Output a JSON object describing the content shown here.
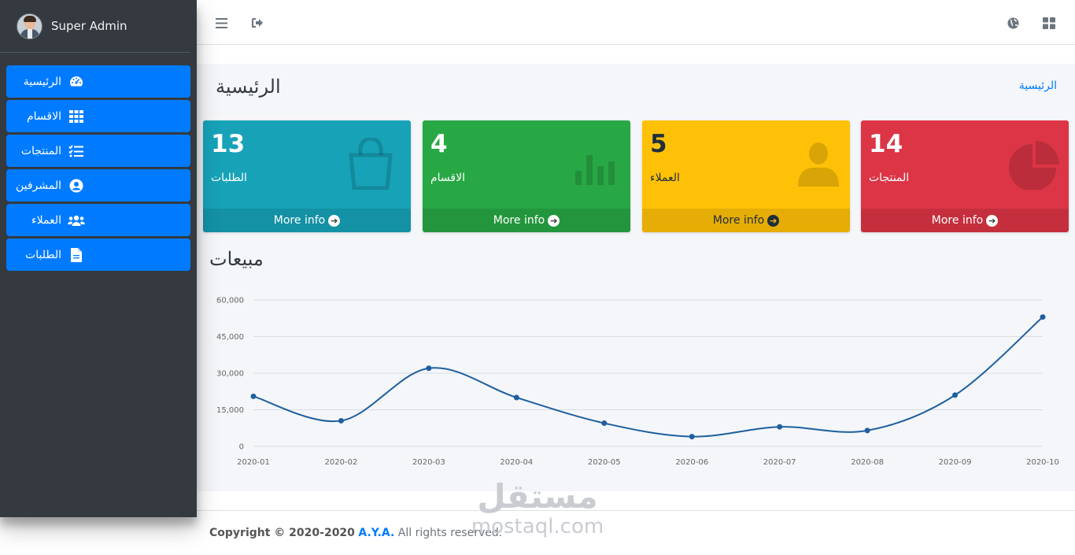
{
  "user": {
    "name": "Super Admin"
  },
  "sidebar": {
    "items": [
      {
        "label": "الرئيسية",
        "icon": "dashboard-icon"
      },
      {
        "label": "الاقسام",
        "icon": "grid-icon"
      },
      {
        "label": "المنتجات",
        "icon": "list-check-icon"
      },
      {
        "label": "المشرفين",
        "icon": "user-circle-icon"
      },
      {
        "label": "العملاء",
        "icon": "users-icon"
      },
      {
        "label": "الطلبات",
        "icon": "file-icon"
      }
    ]
  },
  "header": {
    "icons": [
      "menu-icon",
      "sign-out-icon",
      "globe-icon",
      "apps-icon"
    ]
  },
  "page": {
    "title": "الرئيسية",
    "breadcrumb": "الرئيسية"
  },
  "cards": [
    {
      "value": "13",
      "label": "الطلبات",
      "more": "More info",
      "icon": "shopping-bag-icon",
      "color": "#17a2b8"
    },
    {
      "value": "4",
      "label": "الاقسام",
      "more": "More info",
      "icon": "bar-chart-icon",
      "color": "#28a745"
    },
    {
      "value": "5",
      "label": "العملاء",
      "more": "More info",
      "icon": "user-icon",
      "color": "#ffc107"
    },
    {
      "value": "14",
      "label": "المنتجات",
      "more": "More info",
      "icon": "pie-chart-icon",
      "color": "#dc3545"
    }
  ],
  "chart_section": {
    "title": "مبيعات"
  },
  "chart_data": {
    "type": "line",
    "x": [
      "2020-01",
      "2020-02",
      "2020-03",
      "2020-04",
      "2020-05",
      "2020-06",
      "2020-07",
      "2020-08",
      "2020-09",
      "2020-10"
    ],
    "series": [
      {
        "values": [
          20500,
          10500,
          32000,
          20000,
          9500,
          4000,
          8000,
          6500,
          21000,
          53000
        ],
        "color": "#1f5f9f"
      }
    ],
    "yticks": [
      "0",
      "15,000",
      "30,000",
      "45,000",
      "60,000"
    ],
    "ylim": [
      0,
      60000
    ],
    "grid": true,
    "title": "",
    "xlabel": "",
    "ylabel": ""
  },
  "footer": {
    "prefix": "Copyright © 2020-2020",
    "brand": "A.Y.A.",
    "suffix": "All rights reserved."
  },
  "watermark": {
    "arabic": "مستقل",
    "latin": "mostaql.com"
  }
}
